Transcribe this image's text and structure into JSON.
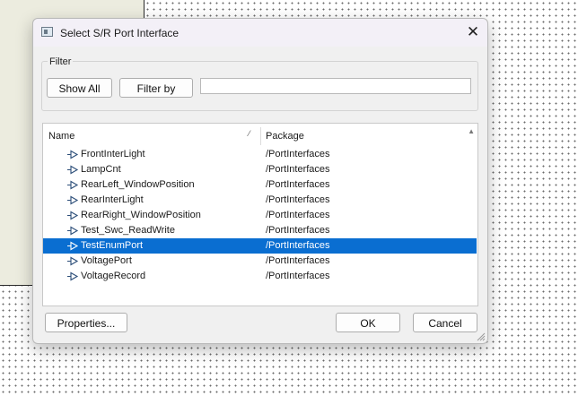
{
  "dialog": {
    "title": "Select S/R Port Interface",
    "close_icon": "close-icon",
    "app_icon": "window-app-icon"
  },
  "filter": {
    "group_label": "Filter",
    "show_all_label": "Show All",
    "filter_by_label": "Filter by",
    "filter_value": "",
    "filter_placeholder": ""
  },
  "list": {
    "columns": {
      "name": "Name",
      "package": "Package"
    },
    "rows": [
      {
        "name": "FrontInterLight",
        "package": "/PortInterfaces",
        "selected": false
      },
      {
        "name": "LampCnt",
        "package": "/PortInterfaces",
        "selected": false
      },
      {
        "name": "RearLeft_WindowPosition",
        "package": "/PortInterfaces",
        "selected": false
      },
      {
        "name": "RearInterLight",
        "package": "/PortInterfaces",
        "selected": false
      },
      {
        "name": "RearRight_WindowPosition",
        "package": "/PortInterfaces",
        "selected": false
      },
      {
        "name": "Test_Swc_ReadWrite",
        "package": "/PortInterfaces",
        "selected": false
      },
      {
        "name": "TestEnumPort",
        "package": "/PortInterfaces",
        "selected": true
      },
      {
        "name": "VoltagePort",
        "package": "/PortInterfaces",
        "selected": false
      },
      {
        "name": "VoltageRecord",
        "package": "/PortInterfaces",
        "selected": false
      }
    ]
  },
  "footer": {
    "properties_label": "Properties...",
    "ok_label": "OK",
    "cancel_label": "Cancel"
  },
  "colors": {
    "selection": "#0a6ed1",
    "dialog_bg": "#f0f0f0",
    "titlebar_bg": "#f3f0f7"
  }
}
